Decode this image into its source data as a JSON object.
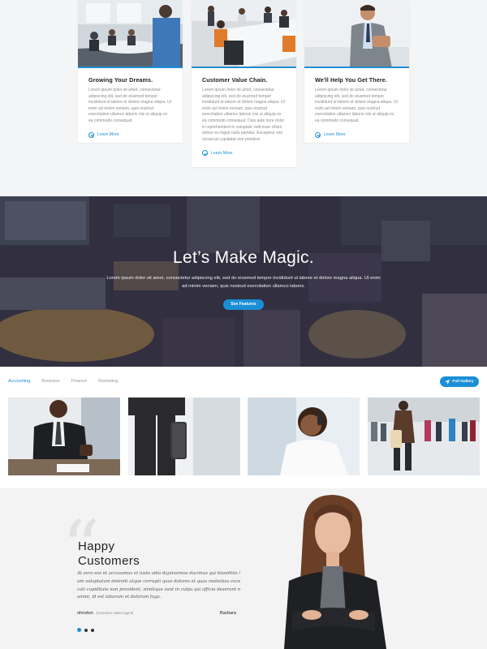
{
  "cards": [
    {
      "title": "Growing Your Dreams.",
      "text": "Lorem ipsum dolor sit amet, consectetur adipiscing elit, sed do eiusmod tempor incididunt ut labore et dolore magna aliqua. Ut enim ad minim veniam, quis nostrud exercitation ullamco laboris nisi ut aliquip ex ea commodo consequat.",
      "link": "Learn More"
    },
    {
      "title": "Customer Value Chain.",
      "text": "Lorem ipsum dolor sit amet, consectetur adipiscing elit, sed do eiusmod tempor incididunt ut labore et dolore magna aliqua. Ut enim ad minim veniam, quis nostrud exercitation ullamco laboris nisi ut aliquip ex ea commodo consequat. Duis aute irure dolor in reprehenderit in voluptate velit esse cillum dolore eu fugiat nulla pariatur. Excepteur sint occaecat cupidatat non proident.",
      "link": "Learn More"
    },
    {
      "title": "We'll Help You Get There.",
      "text": "Lorem ipsum dolor sit amet, consectetur adipiscing elit, sed do eiusmod tempor incididunt ut labore et dolore magna aliqua. Ut enim ad minim veniam, quis nostrud exercitation ullamco laboris nisi ut aliquip ex ea commodo consequat.",
      "link": "Learn More"
    }
  ],
  "banner": {
    "title": "Let’s Make Magic.",
    "text": "Lorem ipsum dolor sit amet, consectetur adipiscing elit, sed do eiusmod tempor incididunt ut labore et dolore magna aliqua. Ut enim ad minim veniam, quis nostrud exercitation ullamco laboris.",
    "button": "See Features"
  },
  "gallery": {
    "tabs": [
      "Accounting",
      "Business",
      "Finance",
      "Marketing"
    ],
    "active_tab": "Accounting",
    "button": "Full Gallery"
  },
  "testimonials": {
    "heading_line1": "Happy",
    "heading_line2": "Customers",
    "quote_lines": [
      "At vero eos et accusamus et iusto odio dignissimos ducimus qui blanditiis  Nam libero tempore",
      "um voluptatum deleniti atque corrupti quos dolores et quas molestias excepturi sint occae",
      "cati cupiditate non provident, similique sunt in culpa qui officia deserunt mollitia",
      "animi, id est laborum et dolorum fuga."
    ],
    "author_name": "ohnston",
    "author_role": "(Insurance Sales Agent)",
    "author_next": "Barbara"
  },
  "colors": {
    "accent": "#1b8fd6"
  }
}
